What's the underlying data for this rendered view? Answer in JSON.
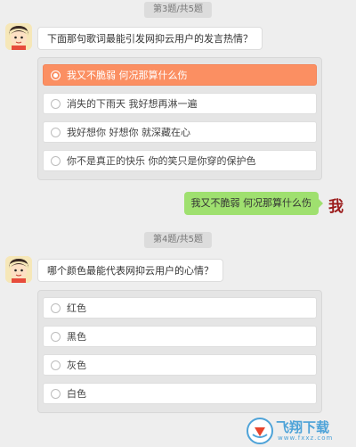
{
  "question3": {
    "progress": "第3题/共5题",
    "text": "下面那句歌词最能引发网抑云用户的发言热情？",
    "options": [
      {
        "label": "我又不脆弱 何况那算什么伤",
        "selected": true
      },
      {
        "label": "消失的下雨天 我好想再淋一遍",
        "selected": false
      },
      {
        "label": "我好想你 好想你 就深藏在心",
        "selected": false
      },
      {
        "label": "你不是真正的快乐 你的笑只是你穿的保护色",
        "selected": false
      }
    ],
    "answer": "我又不脆弱 何况那算什么伤",
    "user_tag": "我"
  },
  "question4": {
    "progress": "第4题/共5题",
    "text": "哪个颜色最能代表网抑云用户的心情？",
    "options": [
      {
        "label": "红色",
        "selected": false
      },
      {
        "label": "黑色",
        "selected": false
      },
      {
        "label": "灰色",
        "selected": false
      },
      {
        "label": "白色",
        "selected": false
      }
    ]
  },
  "watermark": {
    "brand": "飞翔下载",
    "domain": "www.fxxz.com"
  },
  "colors": {
    "selected_option": "#fb8f62",
    "answer_bubble": "#9fe06f",
    "background": "#eeeeee",
    "user_tag": "#9b1b1b"
  }
}
